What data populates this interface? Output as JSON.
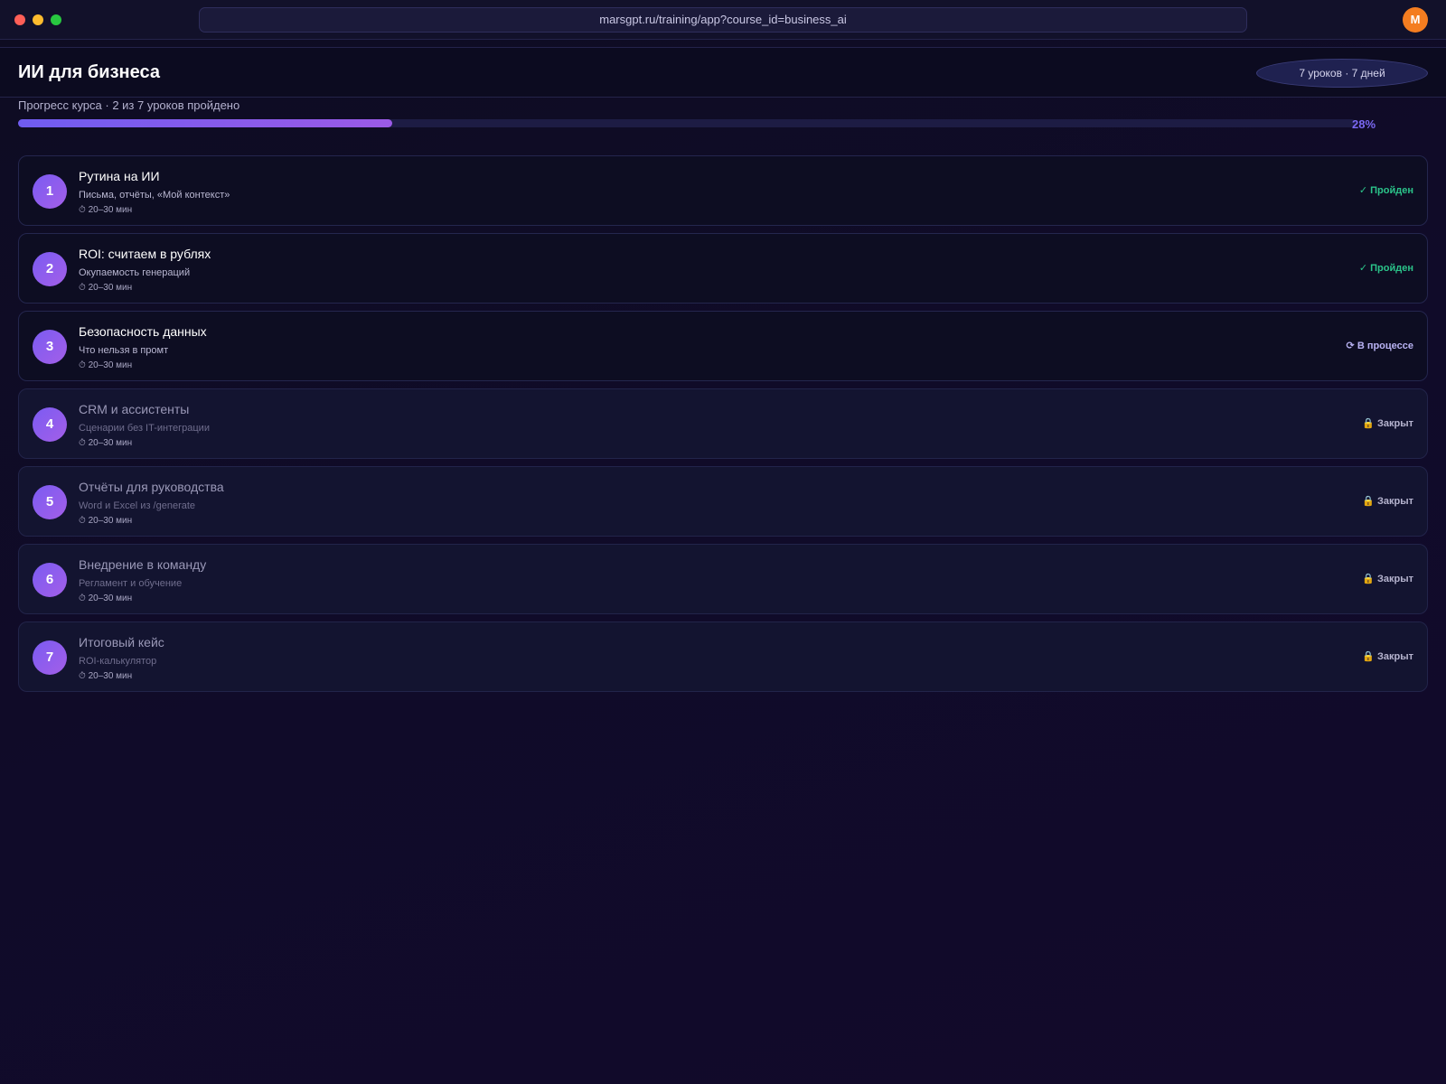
{
  "browser": {
    "url": "marsgpt.ru/training/app?course_id=business_ai",
    "avatar_letter": "M"
  },
  "course": {
    "title": "ИИ для бизнеса",
    "badge": "7 уроков · 7 дней",
    "progress_label": "Прогресс курса · 2 из 7 уроков пройдено",
    "progress_percent_text": "28%",
    "progress_value": 0.28,
    "accent_color": "#7a68f2"
  },
  "status_labels": {
    "done": "✓ Пройден",
    "in_progress": "⟳ В процессе",
    "locked": "🔒 Закрыт"
  },
  "lessons": [
    {
      "number": "1",
      "title": "Рутина на ИИ",
      "subtitle": "Письма, отчёты, «Мой контекст»",
      "duration": "⏱ 20–30 мин",
      "status": "✓ Пройден"
    },
    {
      "number": "2",
      "title": "ROI: считаем в рублях",
      "subtitle": "Окупаемость генераций",
      "duration": "⏱ 20–30 мин",
      "status": "✓ Пройден"
    },
    {
      "number": "3",
      "title": "Безопасность данных",
      "subtitle": "Что нельзя в промт",
      "duration": "⏱ 20–30 мин",
      "status": "⟳ В процессе"
    },
    {
      "number": "4",
      "title": "CRM и ассистенты",
      "subtitle": "Сценарии без IT-интеграции",
      "duration": "⏱ 20–30 мин",
      "status": "🔒 Закрыт"
    },
    {
      "number": "5",
      "title": "Отчёты для руководства",
      "subtitle": "Word и Excel из /generate",
      "duration": "⏱ 20–30 мин",
      "status": "🔒 Закрыт"
    },
    {
      "number": "6",
      "title": "Внедрение в команду",
      "subtitle": "Регламент и обучение",
      "duration": "⏱ 20–30 мин",
      "status": "🔒 Закрыт"
    },
    {
      "number": "7",
      "title": "Итоговый кейс",
      "subtitle": "ROI-калькулятор",
      "duration": "⏱ 20–30 мин",
      "status": "🔒 Закрыт"
    }
  ]
}
